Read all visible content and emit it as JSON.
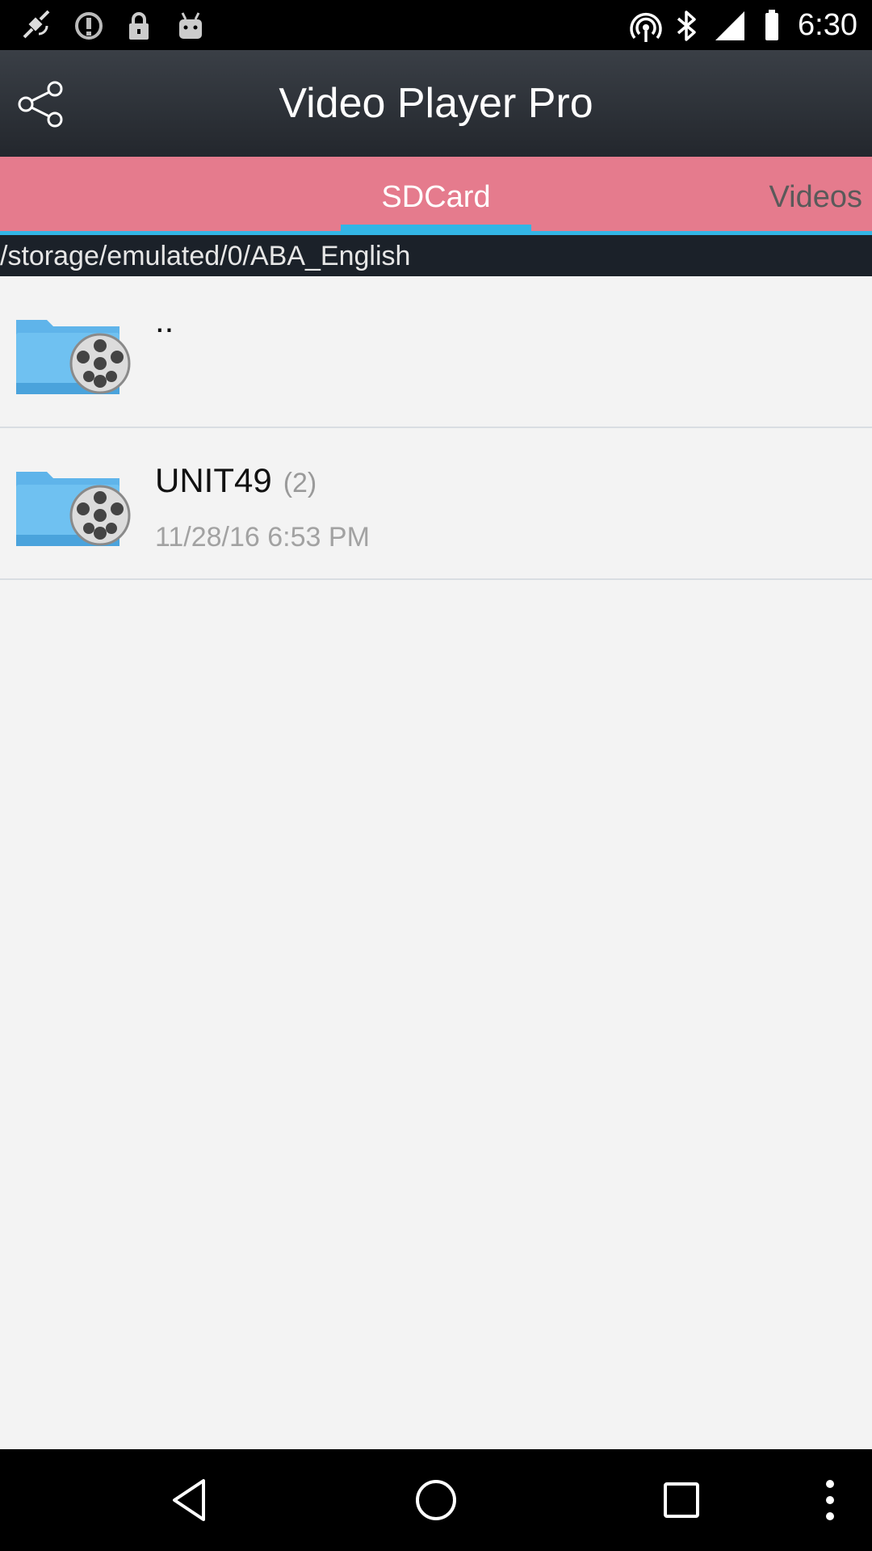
{
  "status_bar": {
    "time": "6:30",
    "left_icons": [
      "fake-gps-icon",
      "alert-icon",
      "lock-icon",
      "android-icon"
    ],
    "right_icons": [
      "hotspot-icon",
      "bluetooth-icon"
    ]
  },
  "title_bar": {
    "title": "Video Player Pro",
    "share_icon": "share-icon"
  },
  "tabs": [
    {
      "label": "SDCard",
      "selected": true
    },
    {
      "label": "Videos",
      "selected": false
    }
  ],
  "path": "/storage/emulated/0/ABA_English",
  "items": [
    {
      "name": "..",
      "count": "",
      "date": "",
      "icon": "video-folder-icon"
    },
    {
      "name": "UNIT49",
      "count": "(2)",
      "date": "11/28/16 6:53 PM",
      "icon": "video-folder-icon"
    }
  ],
  "nav_bar": {
    "buttons": [
      "back-icon",
      "home-icon",
      "recents-icon",
      "menu-icon"
    ]
  },
  "colors": {
    "tab_bar": "#e57b8d",
    "accent": "#33b5e5",
    "title_bar": "#2c3036"
  }
}
